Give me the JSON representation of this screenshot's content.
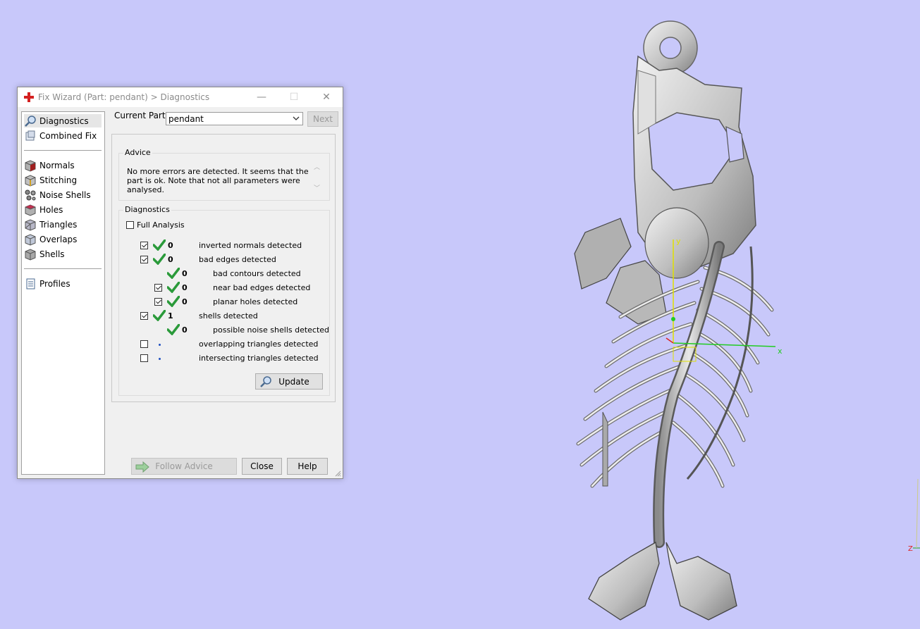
{
  "window": {
    "title": "Fix Wizard (Part: pendant) > Diagnostics",
    "minimize_glyph": "—",
    "maximize_glyph": "☐",
    "close_glyph": "✕"
  },
  "sidebar": {
    "items": [
      {
        "label": "Diagnostics",
        "icon": "magnifier-icon",
        "selected": true
      },
      {
        "label": "Combined Fix",
        "icon": "combined-fix-icon"
      },
      {
        "label": "Normals",
        "icon": "normals-cube-icon"
      },
      {
        "label": "Stitching",
        "icon": "stitching-cube-icon"
      },
      {
        "label": "Noise Shells",
        "icon": "noise-shells-icon"
      },
      {
        "label": "Holes",
        "icon": "holes-cube-icon"
      },
      {
        "label": "Triangles",
        "icon": "triangles-cube-icon"
      },
      {
        "label": "Overlaps",
        "icon": "overlaps-cube-icon"
      },
      {
        "label": "Shells",
        "icon": "shells-cube-icon"
      },
      {
        "label": "Profiles",
        "icon": "profiles-document-icon"
      }
    ]
  },
  "current_part": {
    "label": "Current Part:",
    "value": "pendant",
    "next_label": "Next"
  },
  "advice": {
    "title": "Advice",
    "text": "No more errors are detected. It seems that the part is ok. Note that not all parameters were analysed."
  },
  "diagnostics": {
    "title": "Diagnostics",
    "full_analysis_label": "Full Analysis",
    "full_analysis_checked": false,
    "rows": [
      {
        "checkbox": true,
        "checked": true,
        "status": "ok",
        "count": "0",
        "label": "inverted normals detected",
        "indent": 0
      },
      {
        "checkbox": true,
        "checked": true,
        "status": "ok",
        "count": "0",
        "label": "bad edges detected",
        "indent": 0
      },
      {
        "checkbox": false,
        "checked": false,
        "status": "ok",
        "count": "0",
        "label": "bad contours detected",
        "indent": 1
      },
      {
        "checkbox": true,
        "checked": true,
        "status": "ok",
        "count": "0",
        "label": "near bad edges detected",
        "indent": 1
      },
      {
        "checkbox": true,
        "checked": true,
        "status": "ok",
        "count": "0",
        "label": "planar holes detected",
        "indent": 1
      },
      {
        "checkbox": true,
        "checked": true,
        "status": "ok",
        "count": "1",
        "label": "shells detected",
        "indent": 0
      },
      {
        "checkbox": false,
        "checked": false,
        "status": "ok",
        "count": "0",
        "label": "possible noise shells detected",
        "indent": 1
      },
      {
        "checkbox": true,
        "checked": false,
        "status": "none",
        "count": "",
        "label": "overlapping triangles detected",
        "indent": 0
      },
      {
        "checkbox": true,
        "checked": false,
        "status": "none",
        "count": "",
        "label": "intersecting triangles detected",
        "indent": 0
      }
    ],
    "update_label": "Update"
  },
  "footer": {
    "follow_advice_label": "Follow Advice",
    "close_label": "Close",
    "help_label": "Help"
  },
  "viewport": {
    "axis_x": "x",
    "axis_y": "y",
    "axis_z": "Z",
    "background_color": "#c8c8fa"
  }
}
